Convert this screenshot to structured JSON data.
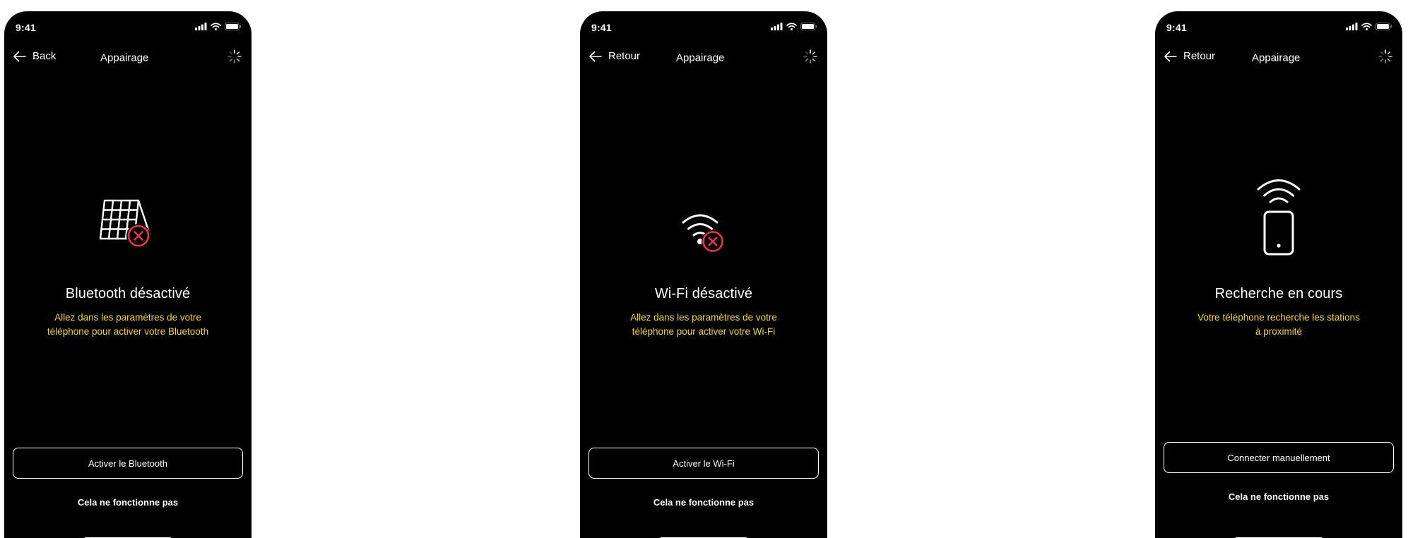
{
  "colors": {
    "background": "#000000",
    "accent_text": "#f5d43a",
    "error": "#e8314f",
    "foreground": "#ffffff"
  },
  "screens": [
    {
      "status_time": "9:41",
      "back_label": "Back",
      "nav_title": "Appairage",
      "hero_icon": "solar-panel-error-icon",
      "title": "Bluetooth désactivé",
      "description_line1": "Allez dans les paramètres de votre",
      "description_line2": "téléphone pour activer votre Bluetooth",
      "primary_button": "Activer le Bluetooth",
      "secondary_link": "Cela ne fonctionne pas"
    },
    {
      "status_time": "9:41",
      "back_label": "Retour",
      "nav_title": "Appairage",
      "hero_icon": "wifi-error-icon",
      "title": "Wi-Fi désactivé",
      "description_line1": "Allez dans les paramètres de votre",
      "description_line2": "téléphone pour activer votre Wi-Fi",
      "primary_button": "Activer le Wi-Fi",
      "secondary_link": "Cela ne fonctionne pas"
    },
    {
      "status_time": "9:41",
      "back_label": "Retour",
      "nav_title": "Appairage",
      "hero_icon": "phone-searching-icon",
      "title": "Recherche en cours",
      "description_line1": "Votre téléphone recherche les stations",
      "description_line2": "à proximité",
      "primary_button": "Connecter manuellement",
      "secondary_link": "Cela ne fonctionne pas"
    }
  ]
}
